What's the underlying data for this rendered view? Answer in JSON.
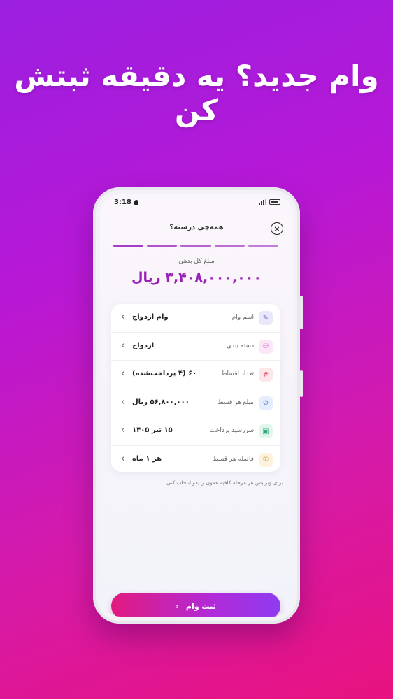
{
  "headline": "وام جدید؟ یه دقیقه ثبتش کن",
  "status_bar": {
    "time": "3:18"
  },
  "header": {
    "title": "همه‌چی درسته؟",
    "close_icon": "close-icon"
  },
  "progress": {
    "steps_total": 5,
    "colors": [
      "#a23ec6",
      "#b054cb",
      "#b462cd",
      "#bc6fd2",
      "#c27dd6"
    ]
  },
  "summary": {
    "label": "مبلغ کل بدهی",
    "amount": "۳,۴۰۸,۰۰۰,۰۰۰ ریال"
  },
  "rows": [
    {
      "label": "اسم وام",
      "value": "وام ازدواج",
      "icon": "pencil-icon",
      "icon_color": "#6b6fd8",
      "icon_bg": "#e9e8fb"
    },
    {
      "label": "دسته بندی",
      "value": "ازدواج",
      "icon": "user-plus-icon",
      "icon_color": "#d056c8",
      "icon_bg": "#fbe8f6"
    },
    {
      "label": "تعداد اقساط",
      "value": "۶۰ (۴ پرداخت‌شده)",
      "icon": "hash-icon",
      "icon_color": "#e0425f",
      "icon_bg": "#fde6ea"
    },
    {
      "label": "مبلغ هر قسط",
      "value": "۵۶,۸۰۰,۰۰۰ ریال",
      "icon": "coin-icon",
      "icon_color": "#5a7ee0",
      "icon_bg": "#e6edfc"
    },
    {
      "label": "سررسید پرداخت",
      "value": "۱۵ تیر ۱۴۰۵",
      "icon": "wallet-icon",
      "icon_color": "#2fa879",
      "icon_bg": "#e3f6ee"
    },
    {
      "label": "فاصله هر قسط",
      "value": "هر ۱ ماه",
      "icon": "clock-icon",
      "icon_color": "#d59a1b",
      "icon_bg": "#fdf2dd"
    }
  ],
  "hint": "برای ویرایش هر مرحله کافیه همون ردیفو انتخاب کنی",
  "submit": {
    "label": "ثبت وام"
  }
}
